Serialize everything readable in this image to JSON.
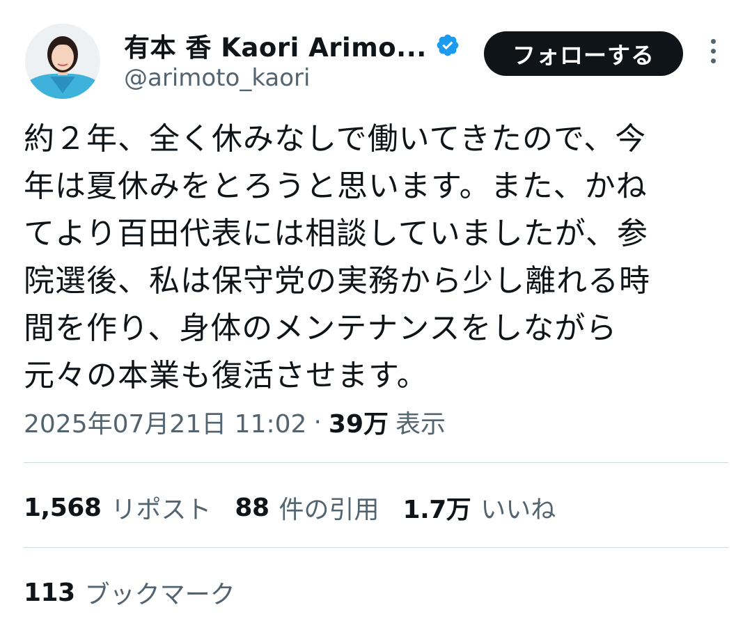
{
  "author": {
    "display_name": "有本 香 Kaori Arimo...",
    "handle": "@arimoto_kaori",
    "verified": true
  },
  "follow_button": {
    "label": "フォローする"
  },
  "tweet": {
    "text": "約２年、全く休みなしで働いてきたので、今\n年は夏休みをとろうと思います。また、かね\nてより百田代表には相談していましたが、参\n院選後、私は保守党の実務から少し離れる時\n間を作り、身体のメンテナンスをしながら\n元々の本業も復活させます。",
    "timestamp": "2025年07月21日 11:02",
    "separator": "·",
    "views_count": "39万",
    "views_label": "表示"
  },
  "stats": {
    "reposts": {
      "count": "1,568",
      "label": "リポスト"
    },
    "quotes": {
      "count": "88",
      "label": "件の引用"
    },
    "likes": {
      "count": "1.7万",
      "label": "いいね"
    },
    "bookmarks": {
      "count": "113",
      "label": "ブックマーク"
    }
  },
  "colors": {
    "text_primary": "#0f1419",
    "text_secondary": "#536471",
    "verified_blue": "#1d9bf0",
    "divider": "#cfd9de",
    "button_bg": "#0f1419"
  }
}
